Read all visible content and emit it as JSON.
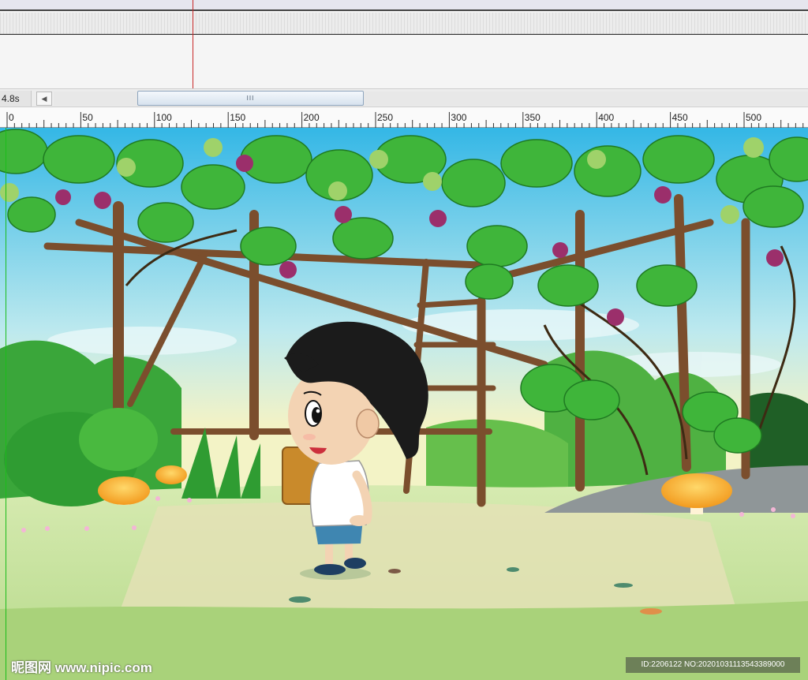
{
  "timeline": {
    "time_readout": "4.8s",
    "scroll_left_glyph": "◀",
    "scroll_grip_glyph": "III"
  },
  "ruler": {
    "labels": [
      "0",
      "50",
      "100",
      "150",
      "200",
      "250",
      "300",
      "350",
      "400",
      "450",
      "500"
    ]
  },
  "stage": {
    "scene": "cartoon boy under grape trellis"
  },
  "watermark": {
    "logo": "昵图网 www.nipic.com",
    "id": "ID:2206122 NO:20201031113543389000"
  },
  "colors": {
    "playhead": "#c82828",
    "guide": "#1bbd1b",
    "sky_top": "#34b7e6",
    "leaf": "#3aa63a",
    "grape": "#9b2f6b",
    "wood": "#8a5a35"
  }
}
